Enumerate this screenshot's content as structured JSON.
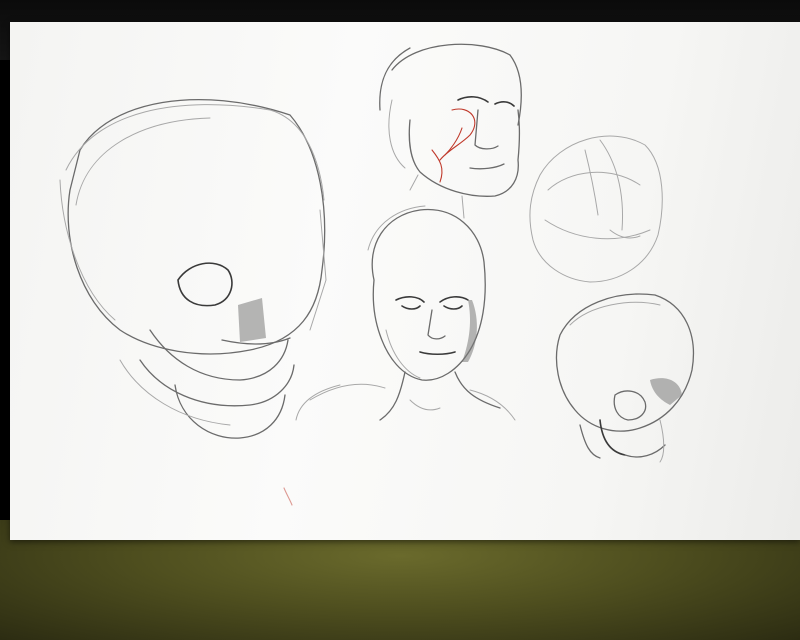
{
  "scene": {
    "description_subjects": [
      "skull-large",
      "head-three-quarter",
      "head-front",
      "skull-outline",
      "skull-small"
    ],
    "colors": {
      "paper": "#f7f7f5",
      "graphite": "#6b6b6b",
      "red_pencil": "#c0392b",
      "couch": "#5a5a24",
      "background": "#0b0b0b"
    }
  }
}
